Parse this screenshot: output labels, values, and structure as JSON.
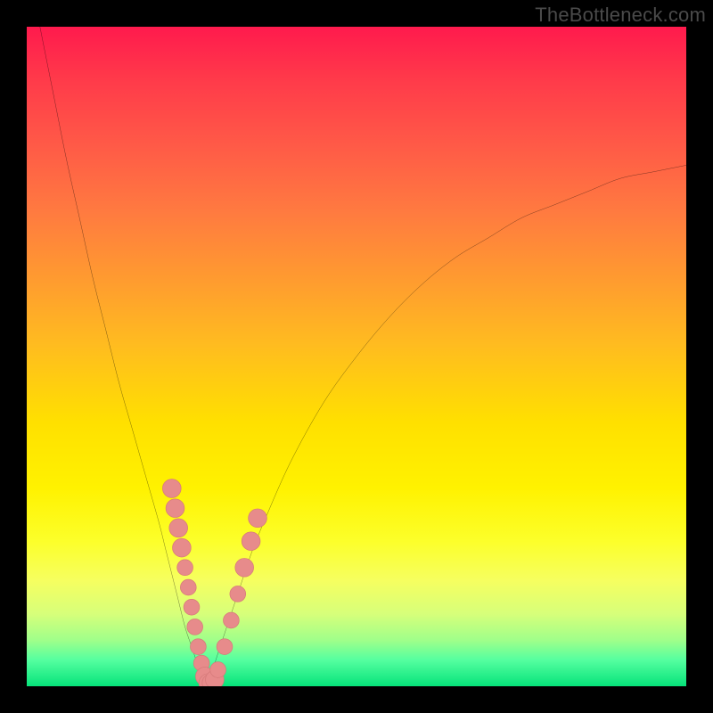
{
  "watermark": "TheBottleneck.com",
  "colors": {
    "curve_stroke": "#000000",
    "marker_fill": "#e78b8b",
    "marker_stroke": "#d67a7a"
  },
  "chart_data": {
    "type": "line",
    "title": "",
    "xlabel": "",
    "ylabel": "",
    "xlim": [
      0,
      100
    ],
    "ylim": [
      0,
      100
    ],
    "series": [
      {
        "name": "left-branch",
        "x": [
          2,
          4,
          6,
          8,
          10,
          12,
          14,
          16,
          18,
          20,
          21,
          22,
          23,
          24,
          25,
          26,
          27
        ],
        "y": [
          100,
          90,
          80,
          71,
          62,
          54,
          46,
          39,
          32,
          25,
          21,
          17,
          13,
          9,
          6,
          3,
          0
        ]
      },
      {
        "name": "right-branch",
        "x": [
          27,
          28,
          29,
          30,
          32,
          34,
          36,
          40,
          45,
          50,
          55,
          60,
          65,
          70,
          75,
          80,
          85,
          90,
          95,
          100
        ],
        "y": [
          0,
          2,
          5,
          8,
          14,
          20,
          25,
          34,
          43,
          50,
          56,
          61,
          65,
          68,
          71,
          73,
          75,
          77,
          78,
          79
        ]
      }
    ],
    "markers": [
      {
        "x": 22.0,
        "y": 30.0,
        "r": 1.4
      },
      {
        "x": 22.5,
        "y": 27.0,
        "r": 1.4
      },
      {
        "x": 23.0,
        "y": 24.0,
        "r": 1.4
      },
      {
        "x": 23.5,
        "y": 21.0,
        "r": 1.4
      },
      {
        "x": 24.0,
        "y": 18.0,
        "r": 1.2
      },
      {
        "x": 24.5,
        "y": 15.0,
        "r": 1.2
      },
      {
        "x": 25.0,
        "y": 12.0,
        "r": 1.2
      },
      {
        "x": 25.5,
        "y": 9.0,
        "r": 1.2
      },
      {
        "x": 26.0,
        "y": 6.0,
        "r": 1.2
      },
      {
        "x": 26.5,
        "y": 3.5,
        "r": 1.2
      },
      {
        "x": 27.0,
        "y": 1.5,
        "r": 1.4
      },
      {
        "x": 27.5,
        "y": 0.5,
        "r": 1.4
      },
      {
        "x": 28.0,
        "y": 0.5,
        "r": 1.4
      },
      {
        "x": 28.5,
        "y": 1.0,
        "r": 1.4
      },
      {
        "x": 29.0,
        "y": 2.5,
        "r": 1.2
      },
      {
        "x": 30.0,
        "y": 6.0,
        "r": 1.2
      },
      {
        "x": 31.0,
        "y": 10.0,
        "r": 1.2
      },
      {
        "x": 32.0,
        "y": 14.0,
        "r": 1.2
      },
      {
        "x": 33.0,
        "y": 18.0,
        "r": 1.4
      },
      {
        "x": 34.0,
        "y": 22.0,
        "r": 1.4
      },
      {
        "x": 35.0,
        "y": 25.5,
        "r": 1.4
      }
    ]
  }
}
